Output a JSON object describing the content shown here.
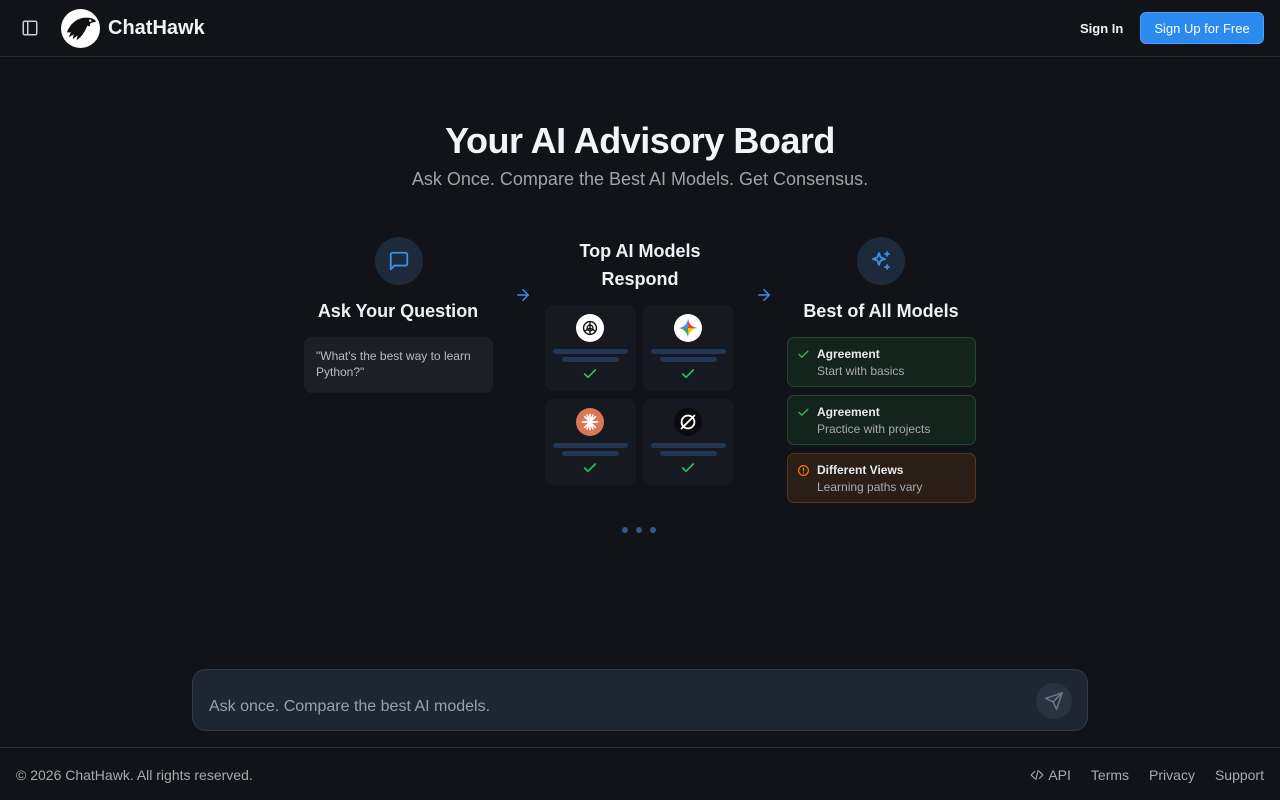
{
  "header": {
    "sidebar_icon": "sidebar-toggle-icon",
    "logo_icon": "hawk-logo-icon",
    "brand": "ChatHawk",
    "signin_label": "Sign In",
    "signup_label": "Sign Up for Free"
  },
  "hero": {
    "title": "Your AI Advisory Board",
    "subtitle": "Ask Once. Compare the Best AI Models. Get Consensus."
  },
  "steps": {
    "ask": {
      "icon": "message-square-icon",
      "title": "Ask Your Question",
      "example": "\"What's the best way to learn Python?\""
    },
    "models": {
      "title_line1": "Top AI Models",
      "title_line2": "Respond",
      "cards": [
        {
          "icon": "openai-logo-icon"
        },
        {
          "icon": "gemini-logo-icon"
        },
        {
          "icon": "claude-logo-icon"
        },
        {
          "icon": "grok-logo-icon"
        }
      ]
    },
    "best": {
      "icon": "sparkles-icon",
      "title": "Best of All Models",
      "results": [
        {
          "type": "agreement",
          "title": "Agreement",
          "text": "Start with basics"
        },
        {
          "type": "agreement",
          "title": "Agreement",
          "text": "Practice with projects"
        },
        {
          "type": "different",
          "title": "Different Views",
          "text": "Learning paths vary"
        }
      ]
    }
  },
  "composer": {
    "placeholder": "Ask once. Compare the best AI models.",
    "send_icon": "send-icon"
  },
  "footer": {
    "copyright": "© 2026 ChatHawk. All rights reserved.",
    "links": {
      "api": "API",
      "terms": "Terms",
      "privacy": "Privacy",
      "support": "Support"
    }
  },
  "colors": {
    "background": "#121318",
    "accent": "#2b8af0",
    "agreement": "#22c55e",
    "different": "#f97316"
  }
}
